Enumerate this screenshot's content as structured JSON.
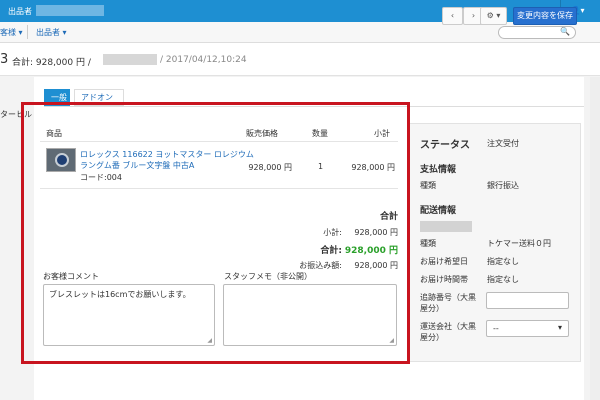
{
  "topbar": {
    "seller_label": "出品者",
    "user_icon_text": "👤▾"
  },
  "filters": {
    "customer_filter": "客様 ▾",
    "seller_filter": "出品者 ▾",
    "search_placeholder": "",
    "search_icon": "🔍"
  },
  "header": {
    "order_number_partial": "3",
    "summary": "合計:  928,000 円 /",
    "date": "/ 2017/04/12,10:24",
    "prev_icon": "‹",
    "next_icon": "›",
    "gear_label": "⚙ ▾",
    "save_button": "変更内容を保存"
  },
  "sidebar": {
    "truncated_note": "ターヒル"
  },
  "tabs": [
    "一般",
    "アドオン"
  ],
  "items_table": {
    "headers": {
      "product": "商品",
      "price": "販売価格",
      "quantity": "数量",
      "subtotal": "小計"
    },
    "rows": [
      {
        "name_line1": "ロレックス 116622 ヨットマスター ロレジウム",
        "name_line2": "ラングム番 ブルー文字盤 中古A",
        "code": "コード:004",
        "price": "928,000 円",
        "quantity": "1",
        "subtotal": "928,000 円"
      }
    ]
  },
  "totals": {
    "heading": "合計",
    "subtotal_label": "小計:",
    "subtotal_value": "928,000 円",
    "total_label": "合計:",
    "total_value": "928,000 円",
    "paid_label": "お振込み額:",
    "paid_value": "928,000 円",
    "total_color": "#2aa02a"
  },
  "comments": {
    "customer_label": "お客様コメント",
    "customer_value": "ブレスレットは16cmでお願いします。",
    "staff_label": "スタッフメモ（非公開）",
    "staff_value": ""
  },
  "right_panel": {
    "status_label": "ステータス",
    "status_value": "注文受付",
    "payment_heading": "支払情報",
    "payment_type_label": "種類",
    "payment_type_value": "銀行振込",
    "shipping_heading": "配送情報",
    "shipping_type_label": "種類",
    "shipping_type_value": "トケマー送料０円",
    "delivery_date_label": "お届け希望日",
    "delivery_date_value": "指定なし",
    "delivery_time_label": "お届け時間帯",
    "delivery_time_value": "指定なし",
    "tracking_label": "追跡番号（大黒屋分）",
    "tracking_value": "",
    "carrier_label": "運送会社（大黒屋分）",
    "carrier_value": "--",
    "carrier_arrow": "▾"
  },
  "colors": {
    "accent": "#1e8fd2",
    "save_button": "#2770cf",
    "highlight_box": "#c8141f"
  }
}
